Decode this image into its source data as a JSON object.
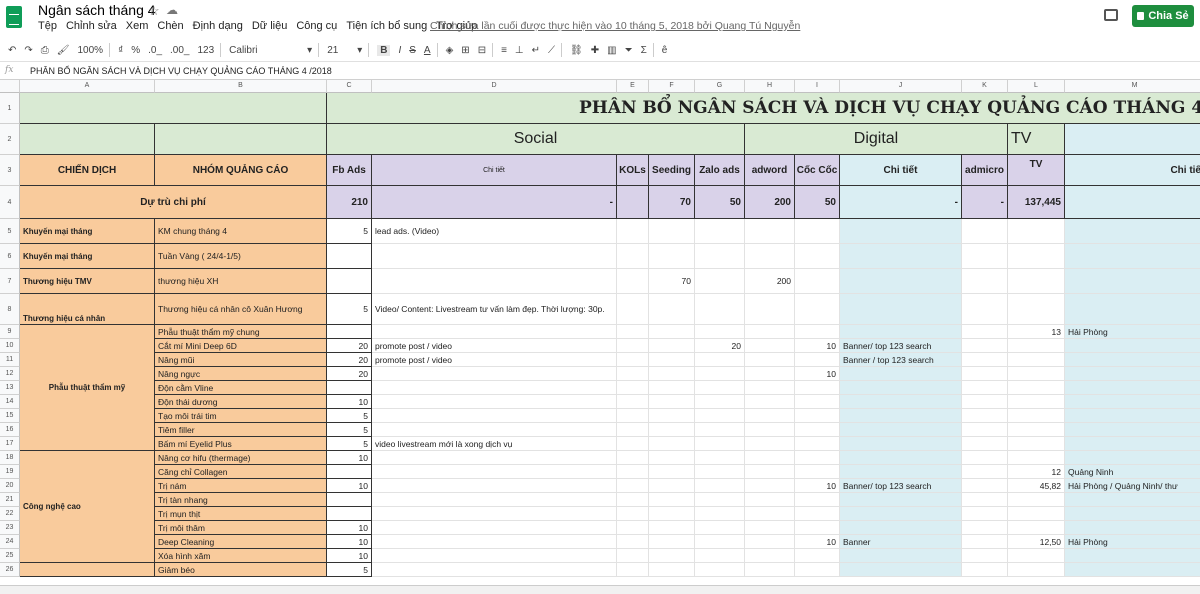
{
  "app": {
    "doc_title": "Ngân sách tháng 4",
    "menus": [
      "Tệp",
      "Chỉnh sửa",
      "Xem",
      "Chèn",
      "Định dạng",
      "Dữ liệu",
      "Công cụ",
      "Tiện ích bổ sung",
      "Trợ giúp"
    ],
    "last_edit": "Chỉnh sửa lần cuối được thực hiện vào 10 tháng 5, 2018 bởi Quang Tú Nguyễn",
    "share_label": "Chia Sẻ"
  },
  "toolbar": {
    "zoom": "100%",
    "currency": "₫",
    "percent": "%",
    "dec_less": ".0_",
    "dec_more": ".00_",
    "format": "123",
    "font": "Calibri",
    "size": "21",
    "bold": "B",
    "italic": "I",
    "strike": "S",
    "textcolor": "A"
  },
  "formula_bar": {
    "fx": "fx",
    "content": "PHÂN BỔ NGÂN SÁCH VÀ DỊCH VỤ CHẠY QUẢNG CÁO THÁNG 4 /2018"
  },
  "columns": [
    "A",
    "B",
    "C",
    "D",
    "E",
    "F",
    "G",
    "H",
    "I",
    "J",
    "K",
    "L",
    "M"
  ],
  "rows_nums": [
    "1",
    "2",
    "3",
    "4",
    "5",
    "6",
    "7",
    "8",
    "9",
    "10",
    "11",
    "12",
    "13",
    "14",
    "15",
    "16",
    "17",
    "18",
    "19",
    "20",
    "21",
    "22",
    "23",
    "24",
    "25",
    "26"
  ],
  "sheet": {
    "title": "PHÂN BỔ NGÂN SÁCH VÀ DỊCH VỤ CHẠY QUẢNG CÁO THÁNG 4 /2018",
    "group_social": "Social",
    "group_digital": "Digital",
    "group_tv": "TV",
    "h_chien_dich": "CHIẾN DỊCH",
    "h_nhom": "NHÓM QUẢNG CÁO",
    "h_fbads": "Fb Ads",
    "h_chitiet": "Chi tiết",
    "h_kols": "KOLs",
    "h_seeding": "Seeding",
    "h_zalo": "Zalo ads",
    "h_adword": "adword",
    "h_coccoc": "Cốc Cốc",
    "h_chitiet2": "Chi tiết",
    "h_admicro": "admicro",
    "h_tv": "TV",
    "h_chitiet3": "Chi tiế",
    "reserve_label": "Dự trù chi phí",
    "reserve": {
      "c": "210",
      "d": "-",
      "f": "70",
      "g": "50",
      "h": "200",
      "i": "50",
      "j": "-",
      "k": "-",
      "l": "137,445"
    },
    "camp_km": "Khuyến mại tháng",
    "camp_km2": "Khuyến mại tháng",
    "camp_tmv": "Thương hiệu TMV",
    "camp_canhan": "Thương hiệu cá nhân",
    "camp_ptm": "Phẫu thuật thẩm mỹ",
    "camp_cnc": "Công nghệ cao",
    "r5": {
      "b": "KM chung tháng 4",
      "c": "5",
      "d": "lead ads. (Video)"
    },
    "r6": {
      "b": "Tuần Vàng ( 24/4-1/5)"
    },
    "r7": {
      "b": "thương hiệu XH",
      "f": "70",
      "h": "200"
    },
    "r8": {
      "b": "Thương hiệu cá nhân cô Xuân Hương",
      "c": "5",
      "d": "Video/ Content: Livestream tư vấn làm đẹp. Thời lượng: 30p."
    },
    "r9": {
      "b": "Phẫu thuật thẩm mỹ chung",
      "l": "13",
      "m": "Hải Phòng"
    },
    "r10": {
      "b": "Cắt mí Mini Deep 6D",
      "c": "20",
      "d": "promote post / video",
      "g": "20",
      "i": "10",
      "j": "Banner/ top 123 search"
    },
    "r11": {
      "b": "Nâng mũi",
      "c": "20",
      "d": "promote post / video",
      "j": "Banner / top 123 search"
    },
    "r12": {
      "b": "Nâng ngực",
      "c": "20",
      "i": "10"
    },
    "r13": {
      "b": "Độn cằm Vline"
    },
    "r14": {
      "b": "Độn thái dương",
      "c": "10"
    },
    "r15": {
      "b": "Tạo môi trái tim",
      "c": "5"
    },
    "r16": {
      "b": "Tiêm filler",
      "c": "5"
    },
    "r17": {
      "b": "Bấm mí Eyelid Plus",
      "c": "5",
      "d": "video livestream mới là xong dịch vụ"
    },
    "r18": {
      "b": "Nâng cơ hifu (thermage)",
      "c": "10"
    },
    "r19": {
      "b": "Căng chỉ Collagen",
      "l": "12",
      "m": "Quảng Ninh"
    },
    "r20": {
      "b": "Trị nám",
      "c": "10",
      "i": "10",
      "j": "Banner/ top 123 search",
      "l": "45,82",
      "m": "Hải Phòng / Quảng Ninh/ thư"
    },
    "r21": {
      "b": "Trị tàn nhang"
    },
    "r22": {
      "b": "Trị mụn thịt"
    },
    "r23": {
      "b": "Trị môi thâm",
      "c": "10"
    },
    "r24": {
      "b": "Deep Cleaning",
      "c": "10",
      "i": "10",
      "j": "Banner",
      "l": "12,50",
      "m": "Hải Phòng"
    },
    "r25": {
      "b": "Xóa hình xăm",
      "c": "10"
    },
    "r26": {
      "b": "Giảm béo",
      "c": "5"
    }
  },
  "colors": {
    "green": "#d9ead3",
    "orange": "#f9cb9c",
    "purple": "#d9d2e9",
    "blue": "#daeef3",
    "share": "#1e8e3e"
  }
}
